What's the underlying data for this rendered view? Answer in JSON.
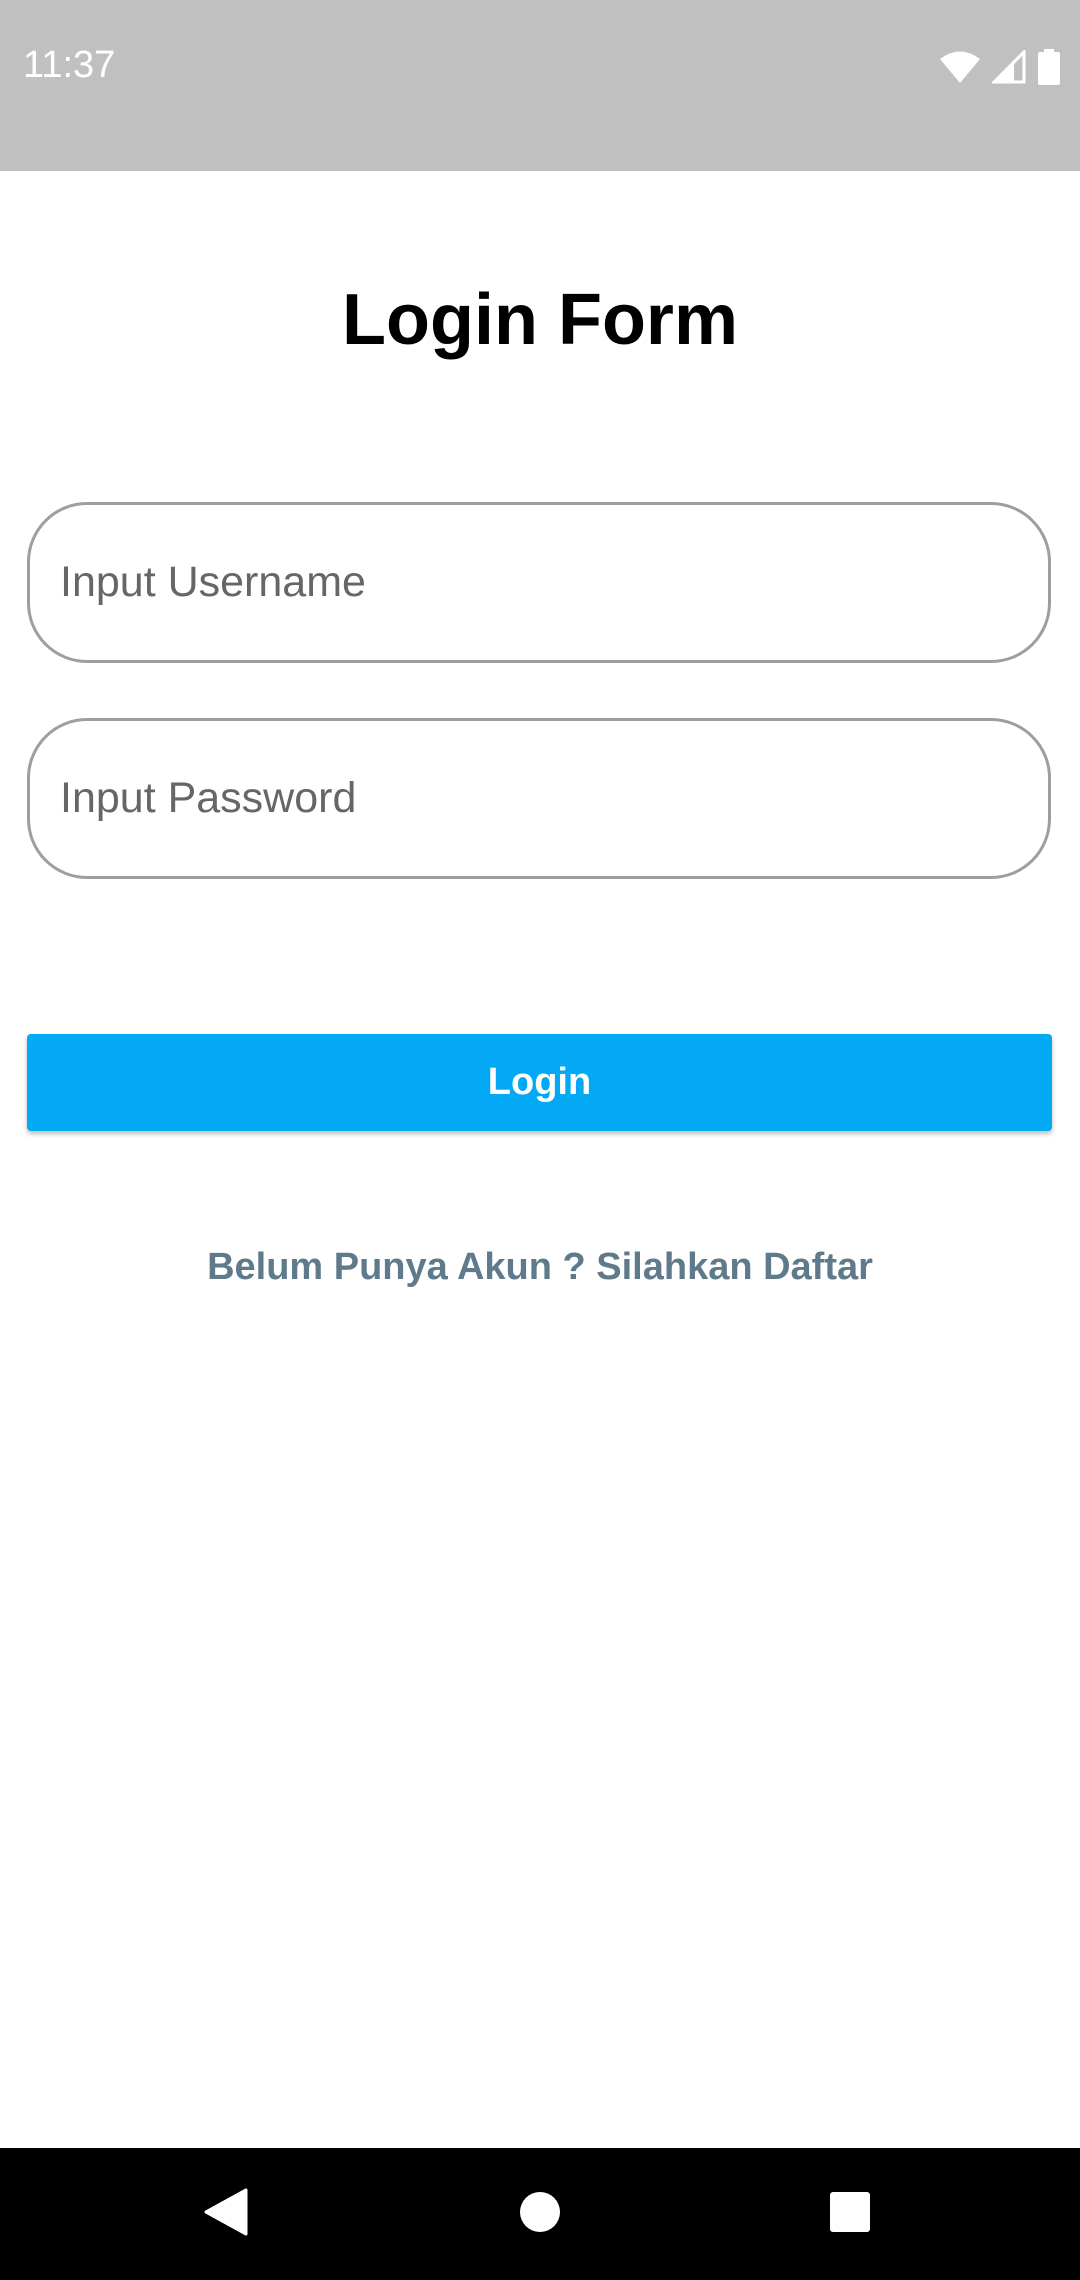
{
  "status_bar": {
    "time": "11:37",
    "icons": [
      "wifi-icon",
      "signal-icon",
      "battery-icon"
    ]
  },
  "login_form": {
    "title": "Login Form",
    "username": {
      "placeholder": "Input Username",
      "value": ""
    },
    "password": {
      "placeholder": "Input Password",
      "value": ""
    },
    "login_label": "Login",
    "register_link": "Belum Punya Akun ? Silahkan Daftar"
  },
  "colors": {
    "status_bar_bg": "#c0c0c0",
    "primary_button": "#03a9f4",
    "link_text": "#5f7a8a",
    "field_border": "#9e9e9e",
    "nav_bar_bg": "#000000"
  },
  "nav_bar": {
    "buttons": [
      "back-icon",
      "home-icon",
      "recent-apps-icon"
    ]
  }
}
